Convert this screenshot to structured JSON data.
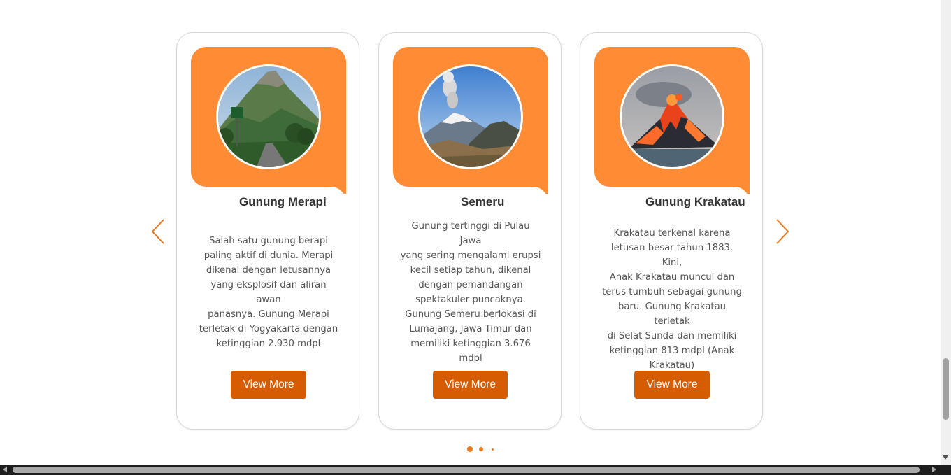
{
  "cards": [
    {
      "title": "Gunung Merapi",
      "image": "volcano-merapi-photo",
      "description": "Salah satu gunung berapi\npaling aktif di dunia. Merapi\ndikenal dengan letusannya\nyang eksplosif dan aliran awan\npanasnya. Gunung Merapi\nterletak di Yogyakarta dengan\nketinggian 2.930 mdpl",
      "button": "View More"
    },
    {
      "title": "Semeru",
      "image": "volcano-semeru-photo",
      "description": "Gunung tertinggi di Pulau Jawa\nyang sering mengalami erupsi\nkecil setiap tahun, dikenal\ndengan pemandangan\nspektakuler puncaknya.\nGunung Semeru berlokasi di\nLumajang, Jawa Timur dan\nmemiliki ketinggian 3.676\nmdpl",
      "button": "View More"
    },
    {
      "title": "Gunung Krakatau",
      "image": "volcano-krakatau-photo",
      "description": "Krakatau terkenal karena\nletusan besar tahun 1883. Kini,\nAnak Krakatau muncul dan\nterus tumbuh sebagai gunung\nbaru. Gunung Krakatau terletak\ndi Selat Sunda dan memiliki\nketinggian 813 mdpl (Anak\nKrakatau)",
      "button": "View More"
    }
  ],
  "carousel": {
    "prev_icon": "chevron-left-icon",
    "next_icon": "chevron-right-icon",
    "dots": 3,
    "active_dot": 1
  },
  "colors": {
    "accent": "#ff8c34",
    "button": "#d55c00",
    "arrow": "#e8781e"
  }
}
